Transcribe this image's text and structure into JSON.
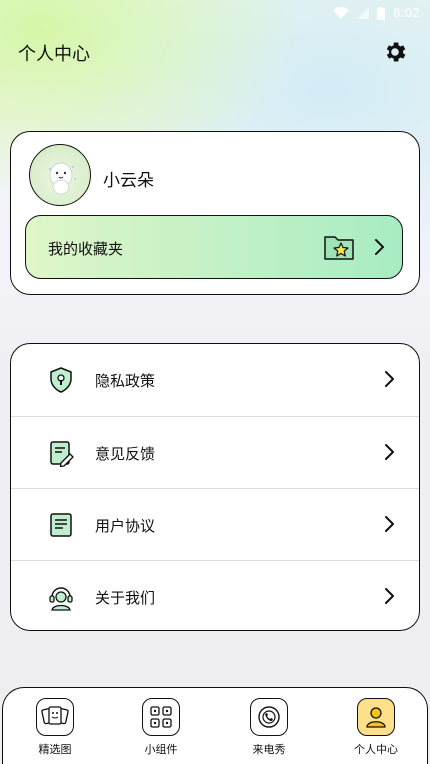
{
  "status_bar": {
    "time": "8:02"
  },
  "header": {
    "title": "个人中心",
    "settings_icon": "gear-icon"
  },
  "profile": {
    "username": "小云朵",
    "favorites_label": "我的收藏夹",
    "favorites_icon": "star-folder-icon"
  },
  "menu": {
    "items": [
      {
        "label": "隐私政策",
        "icon": "shield-lock-icon"
      },
      {
        "label": "意见反馈",
        "icon": "feedback-edit-icon"
      },
      {
        "label": "用户协议",
        "icon": "document-icon"
      },
      {
        "label": "关于我们",
        "icon": "support-agent-icon"
      }
    ]
  },
  "tabbar": {
    "tabs": [
      {
        "label": "精选图",
        "icon": "gallery-icon",
        "active": false
      },
      {
        "label": "小组件",
        "icon": "widgets-icon",
        "active": false
      },
      {
        "label": "来电秀",
        "icon": "call-show-icon",
        "active": false
      },
      {
        "label": "个人中心",
        "icon": "person-icon",
        "active": true
      }
    ]
  },
  "colors": {
    "accent_green": "#a8ecc4",
    "accent_light": "#dff6c8",
    "active_tab": "#ffe08a",
    "border": "#111111"
  }
}
